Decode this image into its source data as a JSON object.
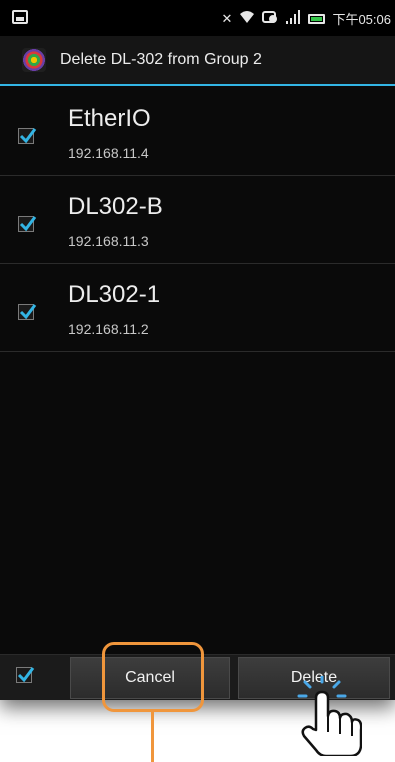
{
  "status_bar": {
    "time": "下午05:06",
    "icons": [
      "screenshot-icon",
      "mute-icon",
      "wifi-icon",
      "sync-icon",
      "signal-icon",
      "battery-icon"
    ]
  },
  "dialog": {
    "title": "Delete DL-302 from Group 2",
    "accent_color": "#33b5e5"
  },
  "devices": [
    {
      "name": "EtherIO",
      "ip": "192.168.11.4",
      "checked": true
    },
    {
      "name": "DL302-B",
      "ip": "192.168.11.3",
      "checked": true
    },
    {
      "name": "DL302-1",
      "ip": "192.168.11.2",
      "checked": true
    }
  ],
  "footer": {
    "select_all_checked": true,
    "cancel_label": "Cancel",
    "delete_label": "Delete"
  },
  "annotation": {
    "highlight_color": "#f0963c",
    "target": "Cancel"
  }
}
